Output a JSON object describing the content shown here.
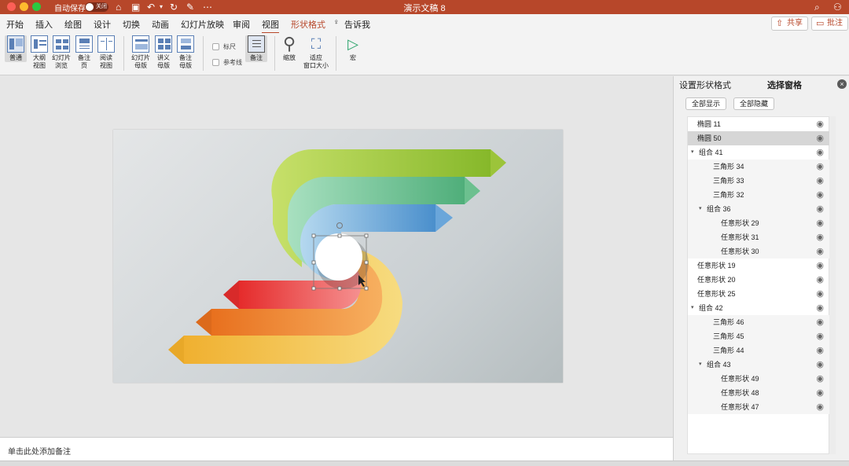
{
  "titlebar": {
    "autosave_label": "自动保存",
    "autosave_state": "关闭",
    "doc_title": "演示文稿 8"
  },
  "ribbon_tabs": [
    "开始",
    "插入",
    "绘图",
    "设计",
    "切换",
    "动画",
    "幻灯片放映",
    "审阅",
    "视图",
    "形状格式",
    "告诉我"
  ],
  "header_buttons": {
    "share": "共享",
    "comments": "批注"
  },
  "toolbar": {
    "normal": "普通",
    "outline": "大纲\n视图",
    "sorter": "幻灯片\n浏览",
    "notes_page": "备注\n页",
    "reading": "阅读\n视图",
    "slide_master": "幻灯片\n母版",
    "handout_master": "讲义\n母版",
    "notes_master": "备注\n母版",
    "ruler": "标尺",
    "guides": "参考线",
    "notes": "备注",
    "zoom": "缩放",
    "fit": "适应\n窗口大小",
    "macro": "宏"
  },
  "notes_placeholder": "单击此处添加备注",
  "pane": {
    "tab_format": "设置形状格式",
    "tab_selection": "选择窗格",
    "show_all": "全部显示",
    "hide_all": "全部隐藏",
    "items": [
      {
        "label": "椭圆 11",
        "level": 0,
        "group": false
      },
      {
        "label": "椭圆 50",
        "level": 0,
        "group": false,
        "selected": true
      },
      {
        "label": "组合 41",
        "level": 0,
        "group": true
      },
      {
        "label": "三角形 34",
        "level": 1,
        "group": false
      },
      {
        "label": "三角形 33",
        "level": 1,
        "group": false
      },
      {
        "label": "三角形 32",
        "level": 1,
        "group": false
      },
      {
        "label": "组合 36",
        "level": 1,
        "group": true
      },
      {
        "label": "任意形状 29",
        "level": 2,
        "group": false
      },
      {
        "label": "任意形状 31",
        "level": 2,
        "group": false
      },
      {
        "label": "任意形状 30",
        "level": 2,
        "group": false
      },
      {
        "label": "任意形状 19",
        "level": 0,
        "group": false
      },
      {
        "label": "任意形状 20",
        "level": 0,
        "group": false
      },
      {
        "label": "任意形状 25",
        "level": 0,
        "group": false
      },
      {
        "label": "组合 42",
        "level": 0,
        "group": true
      },
      {
        "label": "三角形 46",
        "level": 1,
        "group": false
      },
      {
        "label": "三角形 45",
        "level": 1,
        "group": false
      },
      {
        "label": "三角形 44",
        "level": 1,
        "group": false
      },
      {
        "label": "组合 43",
        "level": 1,
        "group": true
      },
      {
        "label": "任意形状 49",
        "level": 2,
        "group": false
      },
      {
        "label": "任意形状 48",
        "level": 2,
        "group": false
      },
      {
        "label": "任意形状 47",
        "level": 2,
        "group": false
      }
    ]
  },
  "colors": {
    "accent": "#b7472a",
    "green": "#8fc03c",
    "teal": "#5fb98a",
    "blue": "#5a9bd0",
    "red": "#e83a3a",
    "orange": "#f08a30",
    "yellow": "#f2c040"
  }
}
